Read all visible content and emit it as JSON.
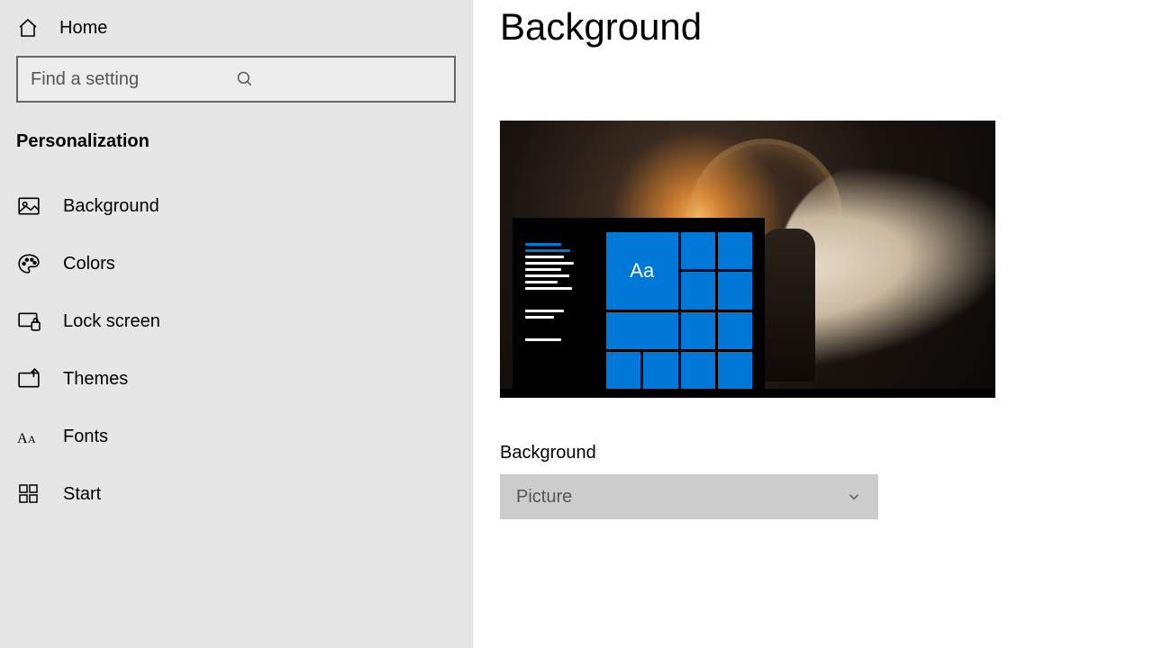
{
  "sidebar": {
    "home": "Home",
    "search_placeholder": "Find a setting",
    "section": "Personalization",
    "items": [
      {
        "icon": "picture-icon",
        "label": "Background"
      },
      {
        "icon": "palette-icon",
        "label": "Colors"
      },
      {
        "icon": "lock-screen-icon",
        "label": "Lock screen"
      },
      {
        "icon": "themes-icon",
        "label": "Themes"
      },
      {
        "icon": "fonts-icon",
        "label": "Fonts"
      },
      {
        "icon": "start-icon",
        "label": "Start"
      }
    ]
  },
  "main": {
    "title": "Background",
    "preview_sample_text": "Aa",
    "field_label": "Background",
    "dropdown_value": "Picture"
  },
  "colors": {
    "accent": "#0078d7"
  }
}
